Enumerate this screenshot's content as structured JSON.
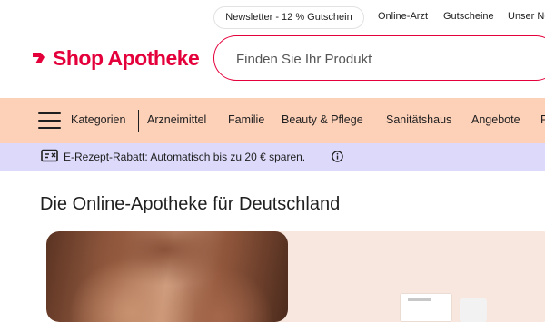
{
  "top_links": {
    "newsletter": "Newsletter - 12 % Gutschein",
    "online_arzt": "Online-Arzt",
    "gutscheine": "Gutscheine",
    "unser": "Unser Ne"
  },
  "logo": {
    "text": "Shop Apotheke",
    "color": "#e4003b"
  },
  "search": {
    "placeholder": "Finden Sie Ihr Produkt"
  },
  "nav": {
    "menu_icon": "hamburger-icon",
    "items": [
      "Kategorien",
      "Arzneimittel",
      "Familie",
      "Beauty & Pflege",
      "Sanitätshaus",
      "Angebote",
      "P"
    ],
    "background": "#fdd0b8"
  },
  "promo": {
    "icon": "prescription-card-icon",
    "text": "E-Rezept-Rabatt: Automatisch bis zu 20 € sparen.",
    "info_icon": "info-icon",
    "background": "#dcd9fb"
  },
  "main": {
    "title": "Die Online-Apotheke für Deutschland"
  }
}
